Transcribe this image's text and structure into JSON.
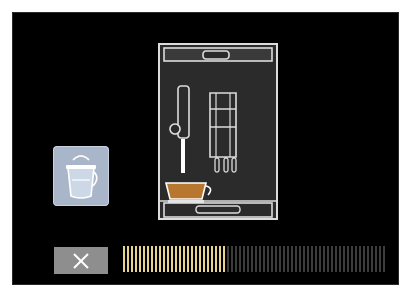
{
  "screen": {
    "status": "rinsing"
  },
  "cancel_button": {
    "icon": "close-icon",
    "color": "#8e8e8e"
  },
  "rinse_indicator": {
    "icon": "milk-carafe-rinse-icon",
    "color": "#a9b6c9"
  },
  "progress": {
    "fraction": 0.39,
    "filled_color": "#e8d38a",
    "empty_color": "#3c3c3c"
  },
  "colors": {
    "background": "#000000",
    "outline": "#d8d8d8",
    "coffee": "#b8772e"
  }
}
